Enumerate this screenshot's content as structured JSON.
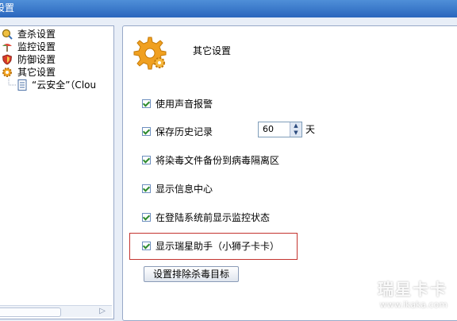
{
  "window": {
    "title": "设置"
  },
  "sidebar": {
    "items": [
      {
        "label": "查杀设置",
        "icon": "scan-icon"
      },
      {
        "label": "监控设置",
        "icon": "monitor-icon"
      },
      {
        "label": "防御设置",
        "icon": "shield-icon"
      },
      {
        "label": "其它设置",
        "icon": "gear-icon"
      },
      {
        "label": "“云安全”（Clou",
        "icon": "document-icon"
      }
    ]
  },
  "main": {
    "title": "其它设置",
    "options": [
      {
        "label": "使用声音报警",
        "checked": true
      },
      {
        "label": "保存历史记录",
        "checked": true
      },
      {
        "label": "将染毒文件备份到病毒隔离区",
        "checked": true
      },
      {
        "label": "显示信息中心",
        "checked": true
      },
      {
        "label": "在登陆系统前显示监控状态",
        "checked": true
      },
      {
        "label": "显示瑞星助手（小狮子卡卡）",
        "checked": true
      }
    ],
    "history_days": "60",
    "history_unit": "天",
    "exclude_button": "设置排除杀毒目标"
  },
  "watermark": {
    "title": "瑞星卡卡",
    "url": "www.ikaka.com"
  }
}
